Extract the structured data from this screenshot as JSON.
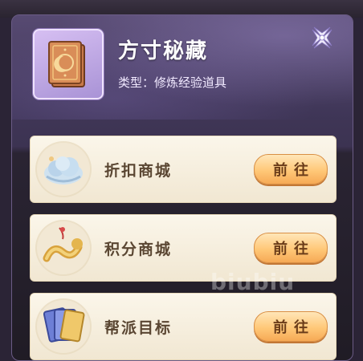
{
  "item": {
    "name": "方寸秘藏",
    "type_text": "类型：修炼经验道具",
    "icon": "book-icon"
  },
  "close": {
    "icon": "close-icon"
  },
  "sources": [
    {
      "label": "折扣商城",
      "button": "前往",
      "icon": "cloud-treasure-icon"
    },
    {
      "label": "积分商城",
      "button": "前往",
      "icon": "gold-dragon-icon"
    },
    {
      "label": "帮派目标",
      "button": "前往",
      "icon": "card-deck-icon"
    }
  ],
  "watermark": "biubiu",
  "colors": {
    "panel_header": "#4b3f63",
    "row_bg": "#f8f0df",
    "button_orange": "#ffc878",
    "label_brown": "#5a4632"
  }
}
